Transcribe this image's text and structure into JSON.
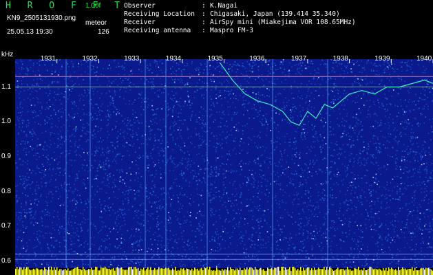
{
  "header": {
    "title": "H R O F F T",
    "version": "1.00f",
    "filename": "KN9_2505131930.png",
    "meteor_label": "meteor",
    "datetime": "25.05.13 19:30",
    "meteor_count": "126",
    "info": [
      {
        "key": "Observer",
        "value": "K.Nagai"
      },
      {
        "key": "Receiving Location",
        "value": "Chigasaki, Japan (139.414 35.340)"
      },
      {
        "key": "Receiver",
        "value": "AirSpy mini (Miakejima VOR 108.65MHz)"
      },
      {
        "key": "Receiving antenna",
        "value": "Maspro FM-3"
      }
    ]
  },
  "chart_data": {
    "type": "heatmap",
    "ylabel": "kHz",
    "x_ticks": [
      "1931",
      "1932",
      "1933",
      "1934",
      "1935",
      "1936",
      "1937",
      "1938",
      "1939",
      "1940"
    ],
    "y_ticks": [
      "1.1",
      "1.0",
      "0.9",
      "0.8",
      "0.7",
      "0.6"
    ],
    "y_values": [
      1.1,
      1.0,
      0.9,
      0.8,
      0.7,
      0.6
    ],
    "ylim": [
      0.58,
      1.18
    ],
    "x_range_minutes": [
      1930,
      1940
    ],
    "colors": {
      "background": "#0a1a8c",
      "noise": "#2a6fe0",
      "trace": "#3cf0c0",
      "carrier": "#ff5050",
      "bottom_bar": "#ffff30"
    }
  }
}
